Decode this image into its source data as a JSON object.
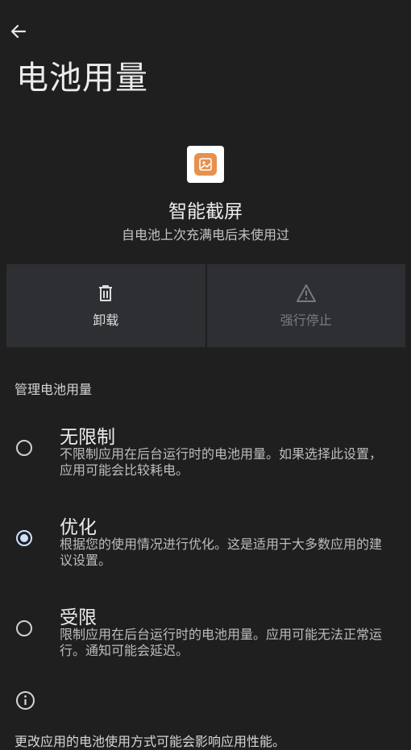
{
  "page_title": "电池用量",
  "app": {
    "name": "智能截屏",
    "status": "自电池上次充满电后未使用过"
  },
  "actions": {
    "uninstall_label": "卸载",
    "force_stop_label": "强行停止"
  },
  "section_title": "管理电池用量",
  "options": [
    {
      "title": "无限制",
      "desc": "不限制应用在后台运行时的电池用量。如果选择此设置，应用可能会比较耗电。",
      "selected": false
    },
    {
      "title": "优化",
      "desc": "根据您的使用情况进行优化。这是适用于大多数应用的建议设置。",
      "selected": true
    },
    {
      "title": "受限",
      "desc": "限制应用在后台运行时的电池用量。应用可能无法正常运行。通知可能会延迟。",
      "selected": false
    }
  ],
  "footer_note": "更改应用的电池使用方式可能会影响应用性能。",
  "icons": {
    "back": "arrow-left-icon",
    "app": "image-icon",
    "uninstall": "trash-icon",
    "force_stop": "warning-icon",
    "info": "info-icon"
  },
  "colors": {
    "background": "#1f1f1f",
    "button_bg": "#2d2f33",
    "app_icon": "#e8904e",
    "radio_checked": "#cfe0ff"
  }
}
